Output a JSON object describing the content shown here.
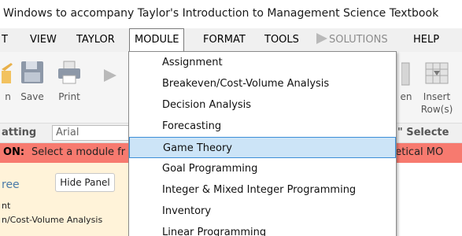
{
  "window": {
    "title": "Windows to accompany Taylor's Introduction to Management Science Textbook"
  },
  "menubar": {
    "items": [
      {
        "key": "t",
        "label": "T",
        "underline": "T"
      },
      {
        "key": "view",
        "label": "VIEW",
        "underline": "V"
      },
      {
        "key": "taylor",
        "label": "TAYLOR",
        "underline": "T"
      },
      {
        "key": "module",
        "label": "MODULE",
        "underline": "M"
      },
      {
        "key": "format",
        "label": "FORMAT",
        "underline": "O"
      },
      {
        "key": "tools",
        "label": "TOOLS",
        "underline": "T"
      },
      {
        "key": "solutions",
        "label": "SOLUTIONS",
        "underline": "S"
      },
      {
        "key": "help",
        "label": "HELP",
        "underline": "H"
      }
    ],
    "open_menu": "MODULE"
  },
  "toolbar": {
    "open_label": "n",
    "save_label": "Save",
    "print_label": "Print",
    "partial_label": "en",
    "insert_label_1": "Insert",
    "insert_label_2": "Row(s)"
  },
  "format_bar": {
    "formatting_label": "atting",
    "font_value": "Arial",
    "right_label": ",\"  Selecte"
  },
  "notice": {
    "label": "ON:",
    "text": "Select a module fr",
    "right_text": "abetical MO"
  },
  "panel": {
    "tree_title": "ree",
    "hide_button": "Hide Panel",
    "tree_line_1": "nt",
    "tree_line_2": "n/Cost-Volume Analysis"
  },
  "module_menu": {
    "highlighted": "Game Theory",
    "items": [
      "Assignment",
      "Breakeven/Cost-Volume Analysis",
      "Decision Analysis",
      "Forecasting",
      "Game Theory",
      "Goal Programming",
      "Integer & Mixed Integer Programming",
      "Inventory",
      "Linear Programming"
    ]
  },
  "colors": {
    "notice_bg": "#f77a6f",
    "panel_bg": "#fff3d9",
    "highlight_bg": "#cce4f7",
    "highlight_border": "#3c8ed8"
  },
  "icons": [
    "save-icon",
    "print-icon",
    "run-icon",
    "insert-row-icon"
  ]
}
